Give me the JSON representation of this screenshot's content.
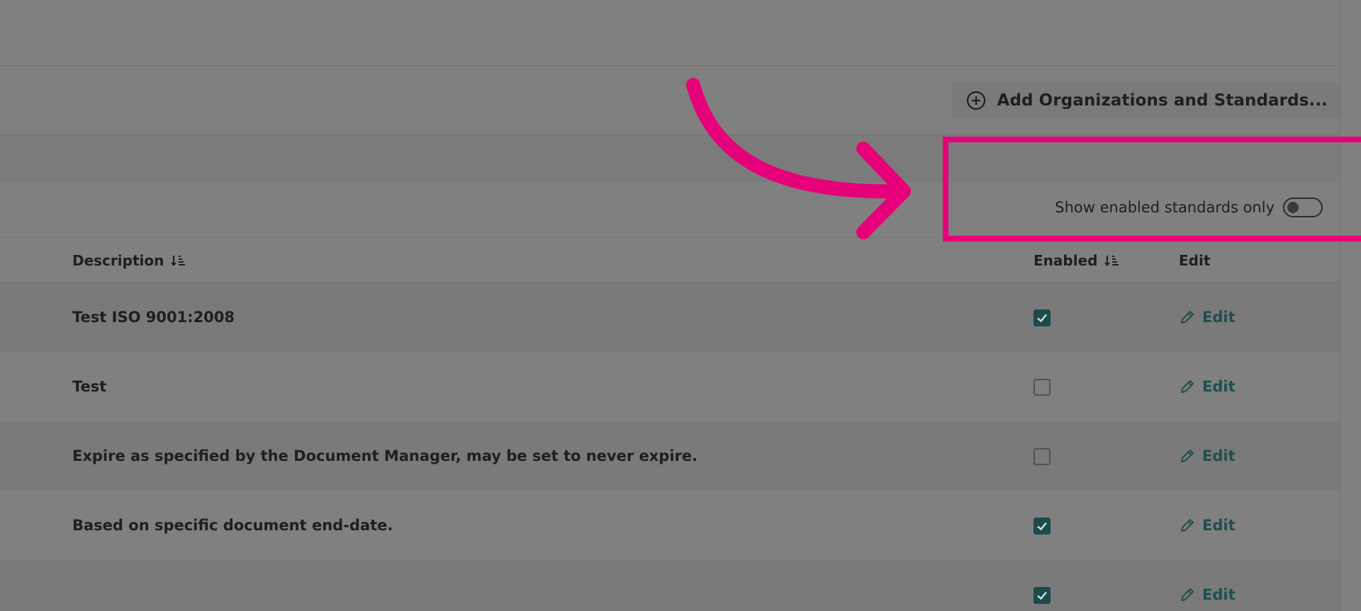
{
  "toolbar": {
    "add_label": "Add Organizations and Standards..."
  },
  "filter": {
    "label": "Show enabled standards only",
    "toggle_on": false
  },
  "table": {
    "columns": {
      "description": "Description",
      "enabled": "Enabled",
      "edit": "Edit"
    },
    "rows": [
      {
        "description": "Test ISO 9001:2008",
        "enabled": true,
        "edit_label": "Edit"
      },
      {
        "description": "Test",
        "enabled": false,
        "edit_label": "Edit"
      },
      {
        "description": "Expire as specified by the Document Manager, may be set to never expire.",
        "enabled": false,
        "edit_label": "Edit"
      },
      {
        "description": "Based on specific document end-date.",
        "enabled": true,
        "edit_label": "Edit"
      },
      {
        "description": "",
        "enabled": true,
        "edit_label": "Edit"
      }
    ]
  },
  "icons": {
    "add": "plus-circle-icon",
    "sort": "sort-icon",
    "edit": "pencil-icon",
    "checkbox": "checkbox-icon"
  },
  "colors": {
    "overlay_bg": "#808080",
    "highlight": "#e6007a",
    "accent_teal": "#1d4a4a"
  }
}
